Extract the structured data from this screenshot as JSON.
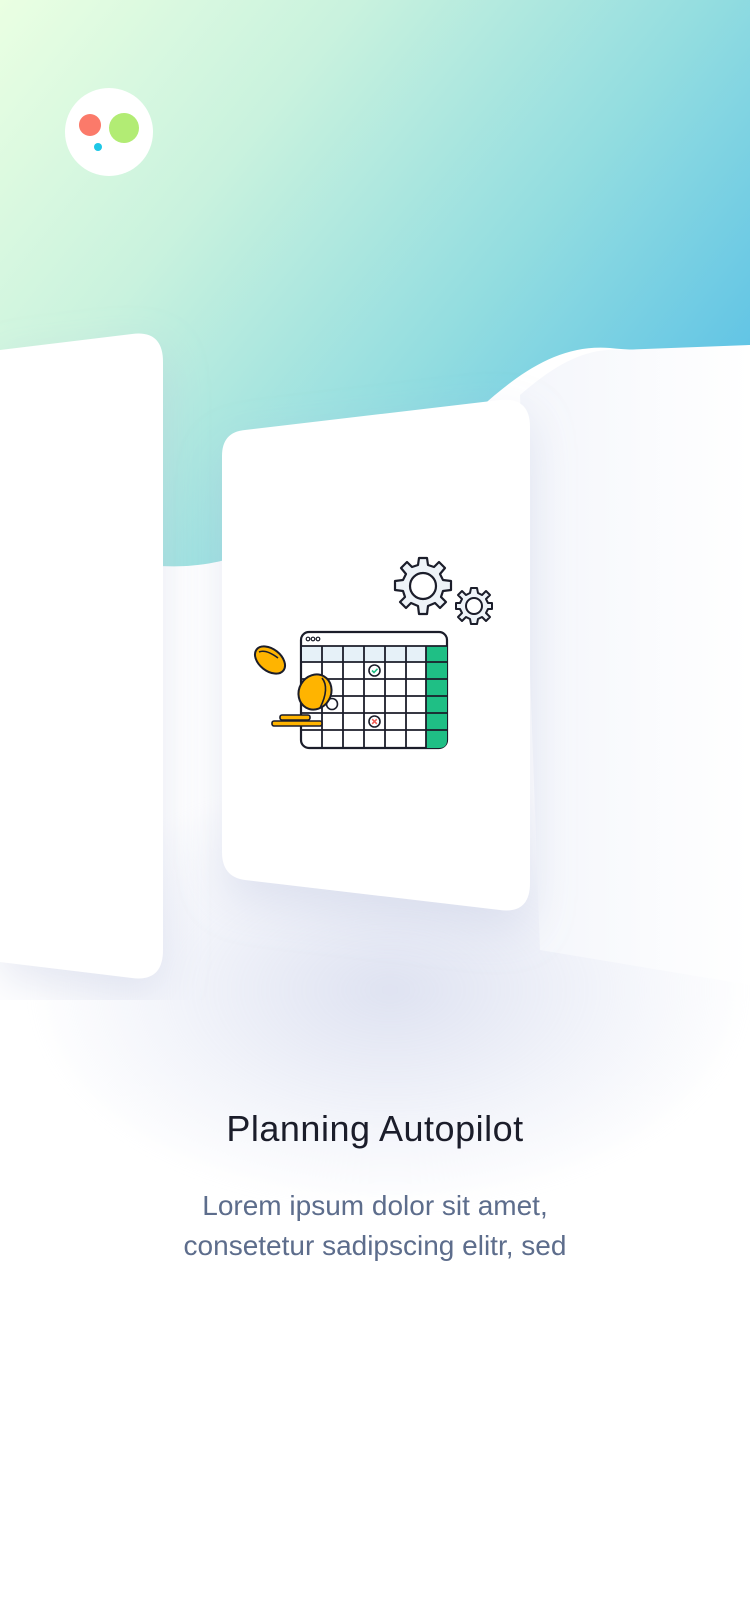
{
  "app": {
    "logo_icon": "three-dots-logo-icon",
    "colors": {
      "logo_red": "#fb7a6a",
      "logo_green": "#b2ec74",
      "logo_blue": "#1ec7e6",
      "gradient_start": "#eaffe2",
      "gradient_end": "#66c6e4",
      "accent_green": "#1fbf85",
      "coin_yellow": "#ffb400"
    }
  },
  "onboarding": {
    "illustration_icon": "calendar-gears-coins-icon",
    "title": "Planning Autopilot",
    "subtitle": "Lorem ipsum dolor sit amet,\nconsetetur sadipscing elitr, sed"
  }
}
